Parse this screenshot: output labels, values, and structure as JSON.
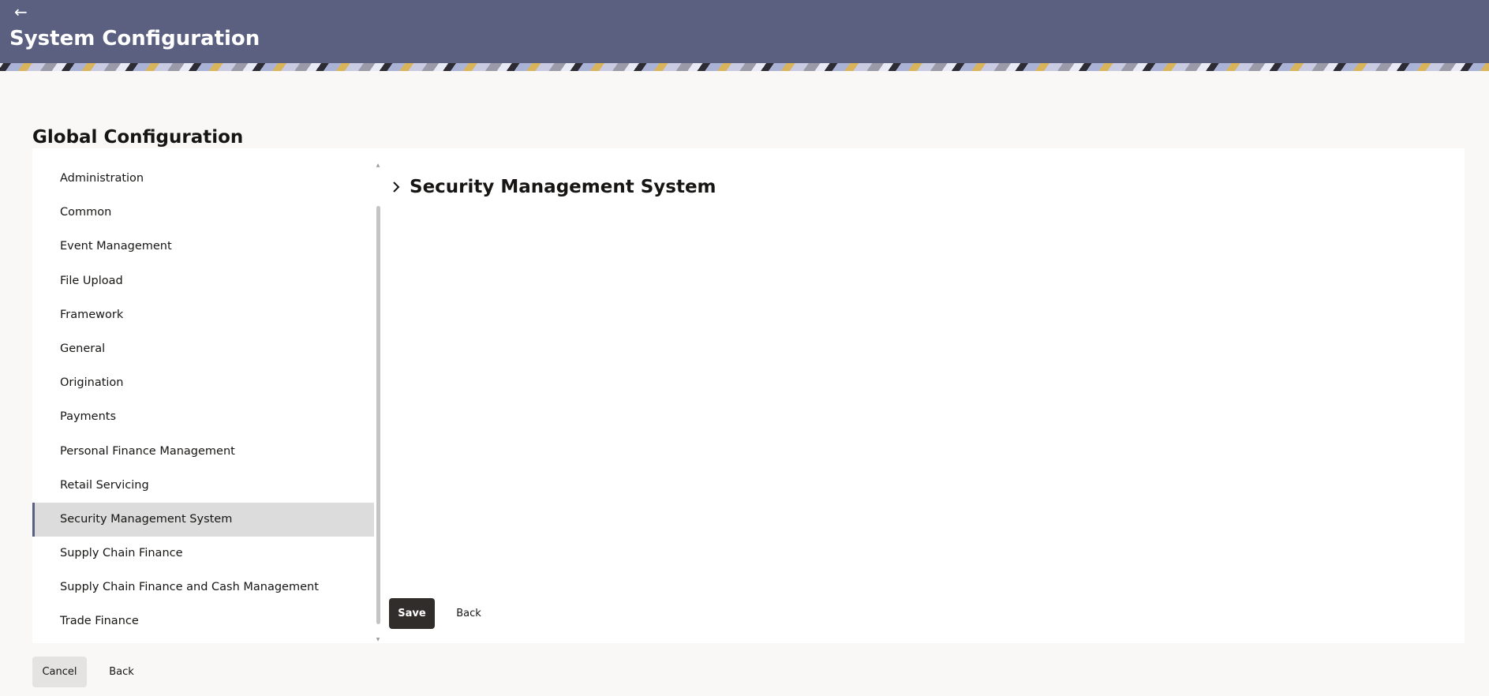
{
  "header": {
    "back_icon": "arrow-left-icon",
    "title": "System Configuration",
    "bg_color": "#5b5f80"
  },
  "section": {
    "title": "Global Configuration"
  },
  "sidebar": {
    "items": [
      {
        "label": "Administration",
        "active": false
      },
      {
        "label": "Common",
        "active": false
      },
      {
        "label": "Event Management",
        "active": false
      },
      {
        "label": "File Upload",
        "active": false
      },
      {
        "label": "Framework",
        "active": false
      },
      {
        "label": "General",
        "active": false
      },
      {
        "label": "Origination",
        "active": false
      },
      {
        "label": "Payments",
        "active": false
      },
      {
        "label": "Personal Finance Management",
        "active": false
      },
      {
        "label": "Retail Servicing",
        "active": false
      },
      {
        "label": "Security Management System",
        "active": true
      },
      {
        "label": "Supply Chain Finance",
        "active": false
      },
      {
        "label": "Supply Chain Finance and Cash Management",
        "active": false
      },
      {
        "label": "Trade Finance",
        "active": false
      }
    ]
  },
  "detail": {
    "expand_icon": "chevron-right-icon",
    "title": "Security Management System",
    "save_label": "Save",
    "back_label": "Back"
  },
  "footer": {
    "cancel_label": "Cancel",
    "back_label": "Back"
  },
  "colors": {
    "primary_button": "#312d2a",
    "active_item_bg": "#dcdcdc"
  }
}
